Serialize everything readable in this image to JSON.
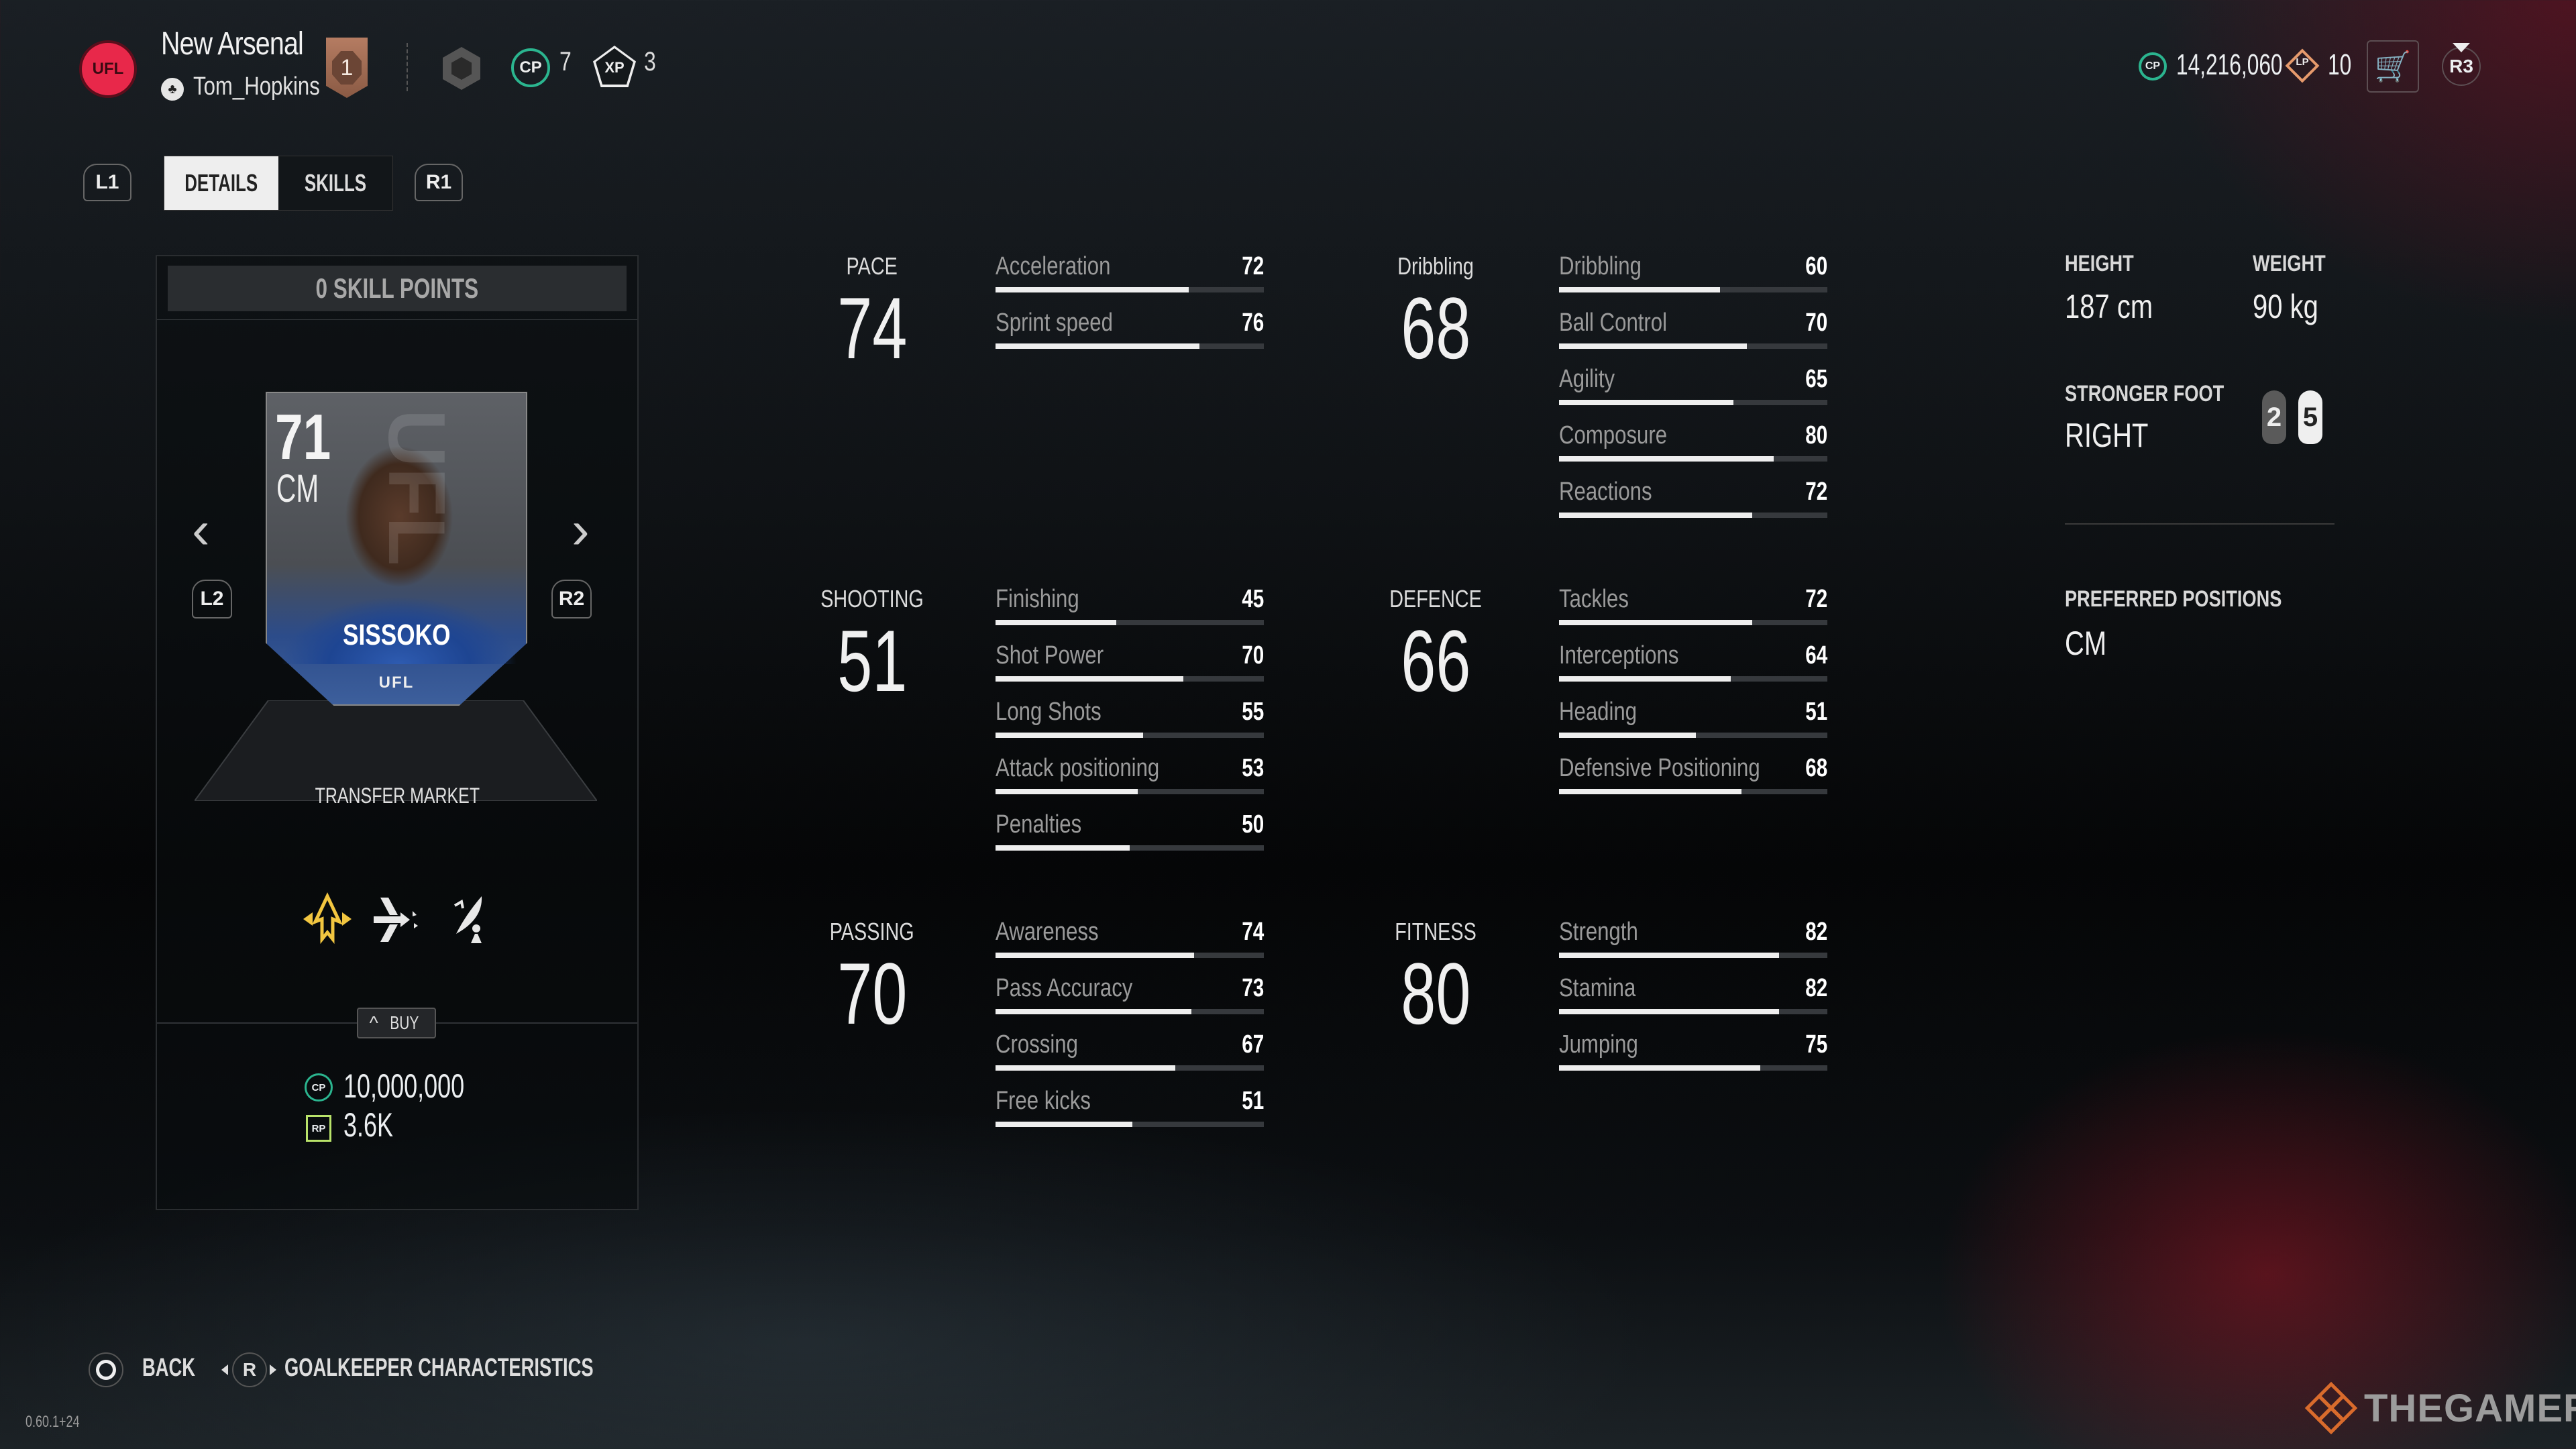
{
  "header": {
    "club_badge_text": "UFL",
    "club_name": "New Arsenal",
    "platform_icon": "playstation-icon",
    "username": "Tom_Hopkins",
    "rank": "1",
    "cp_label": "CP",
    "cp_level": "7",
    "xp_label": "XP",
    "xp_level": "3",
    "currency_cp_label": "CP",
    "currency_cp": "14,216,060",
    "currency_lp_label": "LP",
    "currency_lp": "10",
    "cart_icon": "shopping-cart-icon",
    "r3_label": "R3"
  },
  "tabs": {
    "left_trigger": "L1",
    "right_trigger": "R1",
    "items": [
      {
        "label": "DETAILS",
        "active": true
      },
      {
        "label": "SKILLS",
        "active": false
      }
    ]
  },
  "player_card": {
    "skill_points": "0 SKILL POINTS",
    "overall": "71",
    "position": "CM",
    "name": "SISSOKO",
    "brand": "UFL",
    "watermark": "UFL",
    "prev_trigger": "L2",
    "next_trigger": "R2",
    "prev_arrow": "‹",
    "next_arrow": "›",
    "source": "TRANSFER MARKET",
    "traits": [
      {
        "icon": "gold-upward-arrows-trait-icon",
        "color": "#f2c640"
      },
      {
        "icon": "through-pass-trait-icon",
        "color": "#e8e8e8"
      },
      {
        "icon": "satellite-dish-trait-icon",
        "color": "#e8e8e8"
      }
    ],
    "buy_label": "BUY",
    "price_cp_label": "CP",
    "price_cp": "10,000,000",
    "price_rp_label": "RP",
    "price_rp": "3.6K"
  },
  "stats": [
    {
      "group": "PACE",
      "value": "74",
      "attributes": [
        {
          "name": "Acceleration",
          "value": 72
        },
        {
          "name": "Sprint speed",
          "value": 76
        }
      ]
    },
    {
      "group": "Dribbling",
      "value": "68",
      "attributes": [
        {
          "name": "Dribbling",
          "value": 60
        },
        {
          "name": "Ball Control",
          "value": 70
        },
        {
          "name": "Agility",
          "value": 65
        },
        {
          "name": "Composure",
          "value": 80
        },
        {
          "name": "Reactions",
          "value": 72
        }
      ]
    },
    {
      "group": "SHOOTING",
      "value": "51",
      "attributes": [
        {
          "name": "Finishing",
          "value": 45
        },
        {
          "name": "Shot Power",
          "value": 70
        },
        {
          "name": "Long Shots",
          "value": 55
        },
        {
          "name": "Attack positioning",
          "value": 53
        },
        {
          "name": "Penalties",
          "value": 50
        }
      ]
    },
    {
      "group": "DEFENCE",
      "value": "66",
      "attributes": [
        {
          "name": "Tackles",
          "value": 72
        },
        {
          "name": "Interceptions",
          "value": 64
        },
        {
          "name": "Heading",
          "value": 51
        },
        {
          "name": "Defensive Positioning",
          "value": 68
        }
      ]
    },
    {
      "group": "PASSING",
      "value": "70",
      "attributes": [
        {
          "name": "Awareness",
          "value": 74
        },
        {
          "name": "Pass Accuracy",
          "value": 73
        },
        {
          "name": "Crossing",
          "value": 67
        },
        {
          "name": "Free kicks",
          "value": 51
        }
      ]
    },
    {
      "group": "FITNESS",
      "value": "80",
      "attributes": [
        {
          "name": "Strength",
          "value": 82
        },
        {
          "name": "Stamina",
          "value": 82
        },
        {
          "name": "Jumping",
          "value": 75
        }
      ]
    }
  ],
  "attribute_max": 100,
  "info": {
    "height_label": "HEIGHT",
    "height": "187 cm",
    "weight_label": "WEIGHT",
    "weight": "90 kg",
    "foot_label": "STRONGER FOOT",
    "foot": "RIGHT",
    "weak_foot_rating": "2",
    "strong_foot_rating": "5",
    "positions_label": "PREFERRED POSITIONS",
    "positions": "CM"
  },
  "footer": {
    "back_label": "BACK",
    "rstick_label": "R",
    "gk_label": "GOALKEEPER CHARACTERISTICS",
    "version": "0.60.1+24",
    "watermark": "THEGAMER"
  }
}
